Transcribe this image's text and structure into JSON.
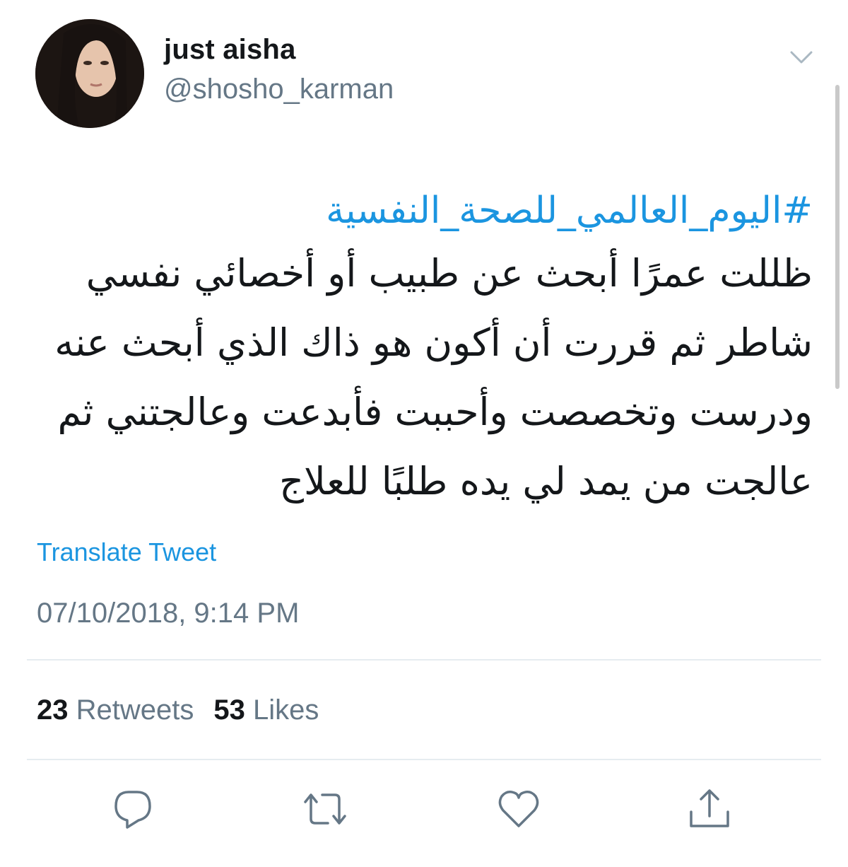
{
  "user": {
    "display_name": "just aisha",
    "handle": "@shosho_karman"
  },
  "tweet": {
    "hashtag": "#اليوم_العالمي_للصحة_النفسية",
    "lines": [
      "ظللت عمرًا أبحث عن طبيب أو أخصائي نفسي",
      "شاطر ثم قررت أن أكون هو ذاك الذي أبحث عنه",
      "ودرست وتخصصت وأحببت فأبدعت وعالجتني ثم",
      "عالجت من يمد لي يده طلبًا للعلاج"
    ],
    "translate_label": "Translate Tweet",
    "timestamp": "07/10/2018, 9:14 PM"
  },
  "stats": {
    "retweets_count": "23",
    "retweets_label": "Retweets",
    "likes_count": "53",
    "likes_label": "Likes"
  },
  "actions": {
    "reply_icon": "reply-icon",
    "retweet_icon": "retweet-icon",
    "like_icon": "heart-icon",
    "share_icon": "share-icon"
  },
  "colors": {
    "link": "#1b95e0",
    "secondary_text": "#657786",
    "primary_text": "#14171a",
    "divider": "#e6ecf0"
  }
}
